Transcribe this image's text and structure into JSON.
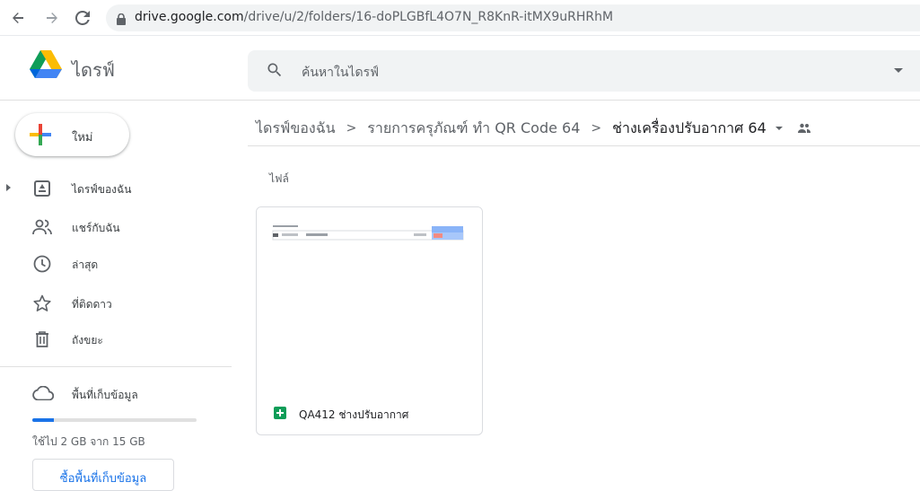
{
  "browser": {
    "url_host": "drive.google.com",
    "url_path": "/drive/u/2/folders/16-doPLGBfL4O7N_R8KnR-itMX9uRHRhM"
  },
  "header": {
    "brand": "ไดรฟ์",
    "search_placeholder": "ค้นหาในไดรฟ์"
  },
  "sidebar": {
    "new_label": "ใหม่",
    "items": [
      {
        "label": "ไดรฟ์ของฉัน",
        "icon": "my-drive-icon"
      },
      {
        "label": "แชร์กับฉัน",
        "icon": "shared-icon"
      },
      {
        "label": "ล่าสุด",
        "icon": "clock-icon"
      },
      {
        "label": "ที่ติดดาว",
        "icon": "star-icon"
      },
      {
        "label": "ถังขยะ",
        "icon": "trash-icon"
      }
    ],
    "storage": {
      "label": "พื้นที่เก็บข้อมูล",
      "used_text": "ใช้ไป 2 GB จาก 15 GB",
      "used_fraction": 0.13,
      "buy_label": "ซื้อพื้นที่เก็บข้อมูล"
    }
  },
  "breadcrumb": {
    "items": [
      "ไดรฟ์ของฉัน",
      "รายการครุภัณฑ์ ทำ QR Code 64",
      "ช่างเครื่องปรับอากาศ 64"
    ],
    "separator": ">"
  },
  "main": {
    "section_title": "ไฟล์",
    "files": [
      {
        "name": "QA412 ช่างปรับอากาศ",
        "type": "sheets-icon"
      }
    ]
  },
  "colors": {
    "accent": "#1a73e8",
    "sheets": "#0f9d58"
  }
}
